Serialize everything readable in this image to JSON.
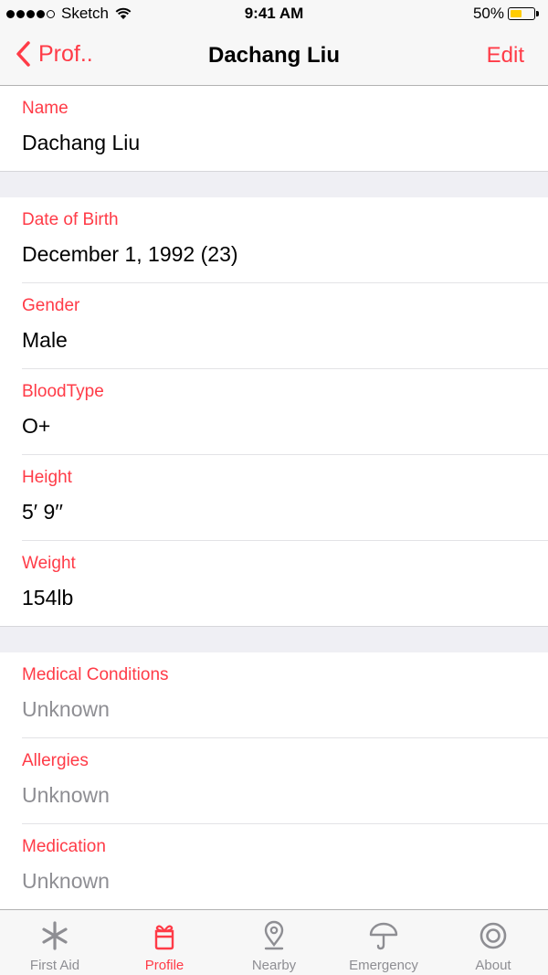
{
  "status_bar": {
    "carrier": "Sketch",
    "time": "9:41 AM",
    "battery": "50%",
    "battery_level": 0.5
  },
  "nav": {
    "back_label": "Prof..",
    "title": "Dachang Liu",
    "edit_label": "Edit"
  },
  "sections": [
    {
      "rows": [
        {
          "label": "Name",
          "value": "Dachang Liu"
        }
      ]
    },
    {
      "rows": [
        {
          "label": "Date of Birth",
          "value": "December 1, 1992 (23)"
        },
        {
          "label": "Gender",
          "value": "Male"
        },
        {
          "label": "BloodType",
          "value": "O+"
        },
        {
          "label": "Height",
          "value": "5′ 9′′"
        },
        {
          "label": "Weight",
          "value": "154lb"
        }
      ]
    },
    {
      "rows": [
        {
          "label": "Medical Conditions",
          "value": "Unknown"
        },
        {
          "label": "Allergies",
          "value": "Unknown"
        },
        {
          "label": "Medication",
          "value": "Unknown"
        }
      ]
    }
  ],
  "tabs": [
    {
      "label": "First Aid",
      "icon": "asterisk-icon"
    },
    {
      "label": "Profile",
      "icon": "profile-icon",
      "active": true
    },
    {
      "label": "Nearby",
      "icon": "location-pin-icon"
    },
    {
      "label": "Emergency",
      "icon": "umbrella-icon"
    },
    {
      "label": "About",
      "icon": "target-icon"
    }
  ],
  "colors": {
    "accent": "#ff3b47",
    "muted": "#8e8e93",
    "background": "#efeff4"
  }
}
